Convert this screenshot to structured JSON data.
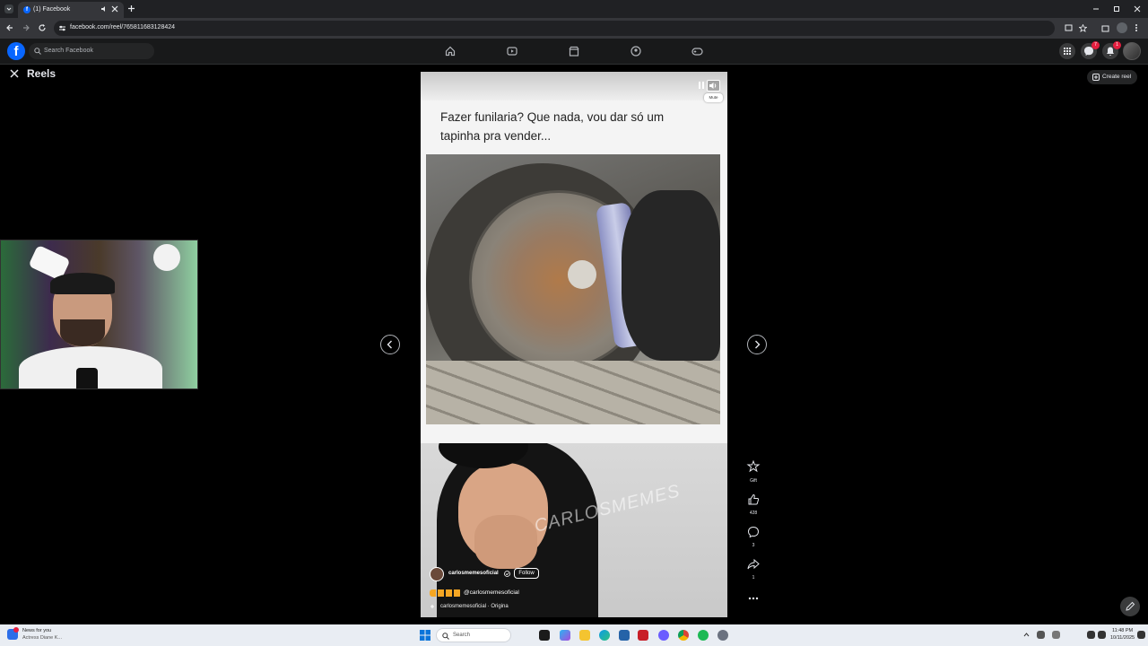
{
  "browser": {
    "tab_title": "(1) Facebook",
    "url": "facebook.com/reel/765811683128424"
  },
  "header": {
    "search_placeholder": "Search Facebook",
    "messenger_badge": "7",
    "notifications_badge": "1"
  },
  "reels": {
    "title": "Reels",
    "create_label": "Create reel",
    "mute_tooltip": "Mute",
    "caption": "Fazer funilaria? Que nada, vou dar só um tapinha pra vender...",
    "watermark": "CARLOSMEMES",
    "author": "carlosmemesoficial",
    "follow_label": "Follow",
    "handle": "@carlosmemesoficial",
    "audio": "carlosmemesoficial · Origina",
    "actions": {
      "gift_label": "Gift",
      "like_count": "428",
      "comment_count": "3",
      "share_count": "1"
    }
  },
  "taskbar": {
    "news_title": "News for you",
    "news_sub": "Actress Diane K...",
    "search_placeholder": "Search",
    "time": "11:48 PM",
    "date": "10/11/2025"
  },
  "colors": {
    "fb_blue": "#0866ff",
    "background": "#000000",
    "badge_red": "#e41e3f"
  }
}
